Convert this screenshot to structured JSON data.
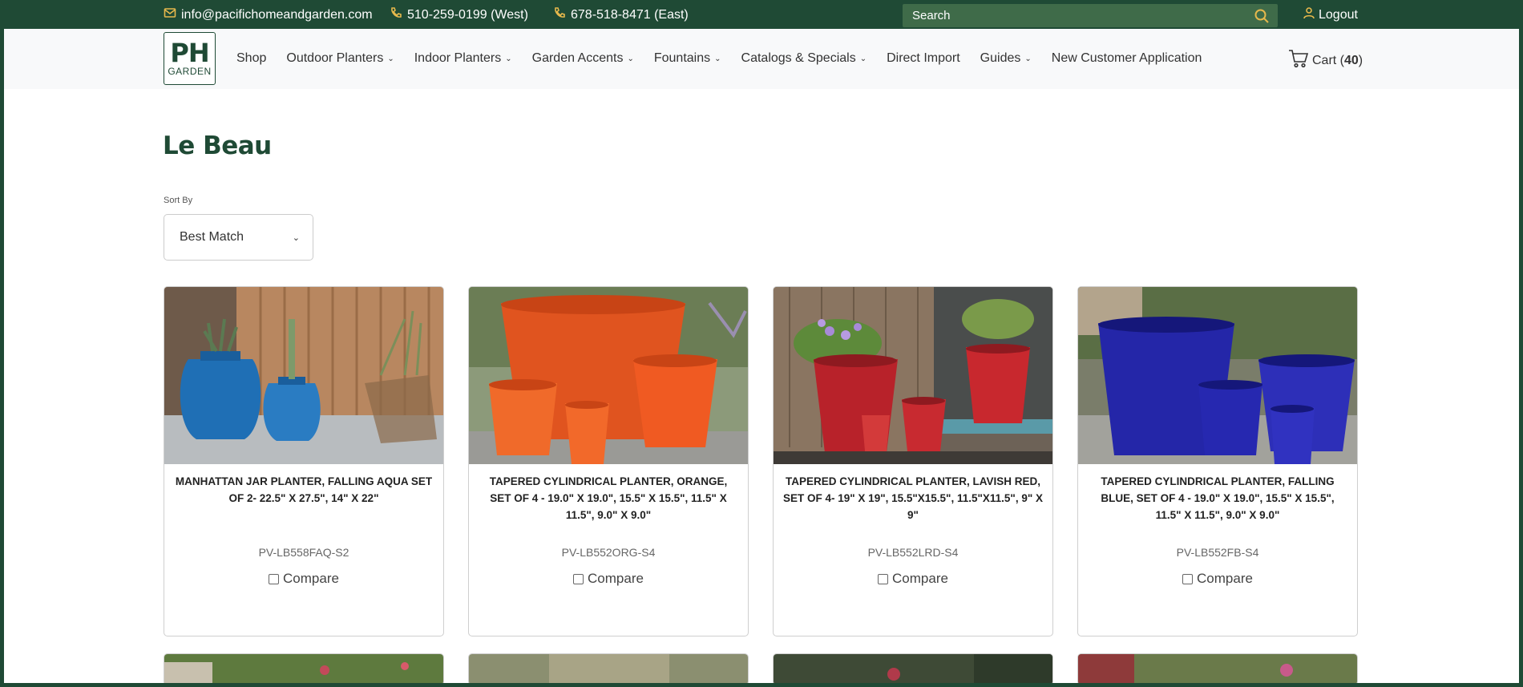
{
  "topbar": {
    "email": "info@pacifichomeandgarden.com",
    "phone_west": "510-259-0199 (West)",
    "phone_east": "678-518-8471 (East)",
    "search_placeholder": "Search",
    "logout": "Logout"
  },
  "logo": {
    "line1": "PH",
    "line2": "GARDEN"
  },
  "nav": {
    "items": [
      {
        "label": "Shop",
        "dropdown": false
      },
      {
        "label": "Outdoor Planters",
        "dropdown": true
      },
      {
        "label": "Indoor Planters",
        "dropdown": true
      },
      {
        "label": "Garden Accents",
        "dropdown": true
      },
      {
        "label": "Fountains",
        "dropdown": true
      },
      {
        "label": "Catalogs & Specials",
        "dropdown": true
      },
      {
        "label": "Direct Import",
        "dropdown": false
      },
      {
        "label": "Guides",
        "dropdown": true
      },
      {
        "label": "New Customer Application",
        "dropdown": false
      }
    ],
    "cart_label": "Cart (",
    "cart_count": "40",
    "cart_close": ")"
  },
  "page": {
    "title": "Le Beau",
    "sort_label": "Sort By",
    "sort_value": "Best Match"
  },
  "products": [
    {
      "name": "MANHATTAN JAR PLANTER, FALLING AQUA SET OF 2- 22.5\" X 27.5\", 14\" X 22\"",
      "sku": "PV-LB558FAQ-S2",
      "compare": "Compare"
    },
    {
      "name": "TAPERED CYLINDRICAL PLANTER, ORANGE, SET OF 4 - 19.0\" X 19.0\", 15.5\" X 15.5\", 11.5\" X 11.5\", 9.0\" X 9.0\"",
      "sku": "PV-LB552ORG-S4",
      "compare": "Compare"
    },
    {
      "name": "TAPERED CYLINDRICAL PLANTER, LAVISH RED, SET OF 4- 19\" X 19\", 15.5\"x15.5\", 11.5\"x11.5\", 9\" X 9\"",
      "sku": "PV-LB552LRD-S4",
      "compare": "Compare"
    },
    {
      "name": "TAPERED CYLINDRICAL PLANTER, FALLING BLUE, SET OF 4 - 19.0\" X 19.0\", 15.5\" X 15.5\", 11.5\" X 11.5\", 9.0\" X 9.0\"",
      "sku": "PV-LB552FB-S4",
      "compare": "Compare"
    }
  ]
}
